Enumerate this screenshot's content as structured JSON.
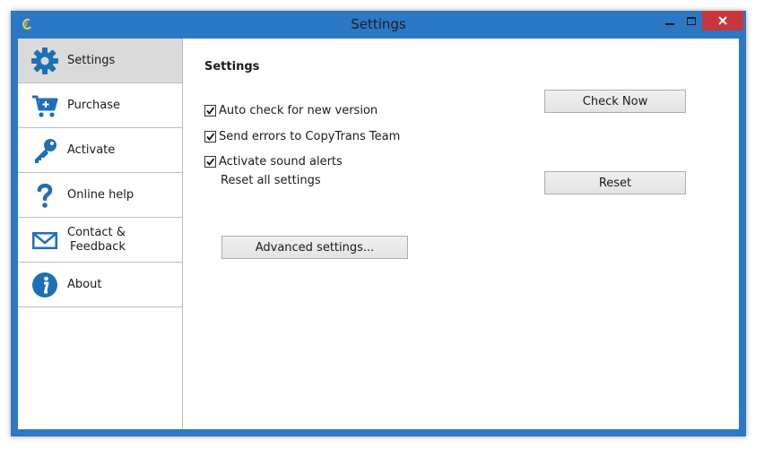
{
  "window": {
    "title": "Settings",
    "accent": "#2b78c5",
    "close_color": "#c7363b"
  },
  "sidebar": {
    "items": [
      {
        "label": "Settings",
        "icon": "gear-icon",
        "active": true
      },
      {
        "label": "Purchase",
        "icon": "cart-icon",
        "active": false
      },
      {
        "label": "Activate",
        "icon": "key-icon",
        "active": false
      },
      {
        "label": "Online help",
        "icon": "question-icon",
        "active": false
      },
      {
        "label_line1": "Contact &",
        "label_line2": "Feedback",
        "icon": "envelope-icon",
        "active": false
      },
      {
        "label": "About",
        "icon": "info-icon",
        "active": false
      }
    ]
  },
  "settings": {
    "title": "Settings",
    "auto_check": {
      "label": "Auto check for new version",
      "checked": true
    },
    "send_errors": {
      "label": "Send errors to CopyTrans Team",
      "checked": true
    },
    "sound_alerts": {
      "label": "Activate sound alerts",
      "checked": true
    },
    "reset_label": "Reset all settings",
    "check_now_button": "Check Now",
    "reset_button": "Reset",
    "advanced_button": "Advanced settings..."
  }
}
